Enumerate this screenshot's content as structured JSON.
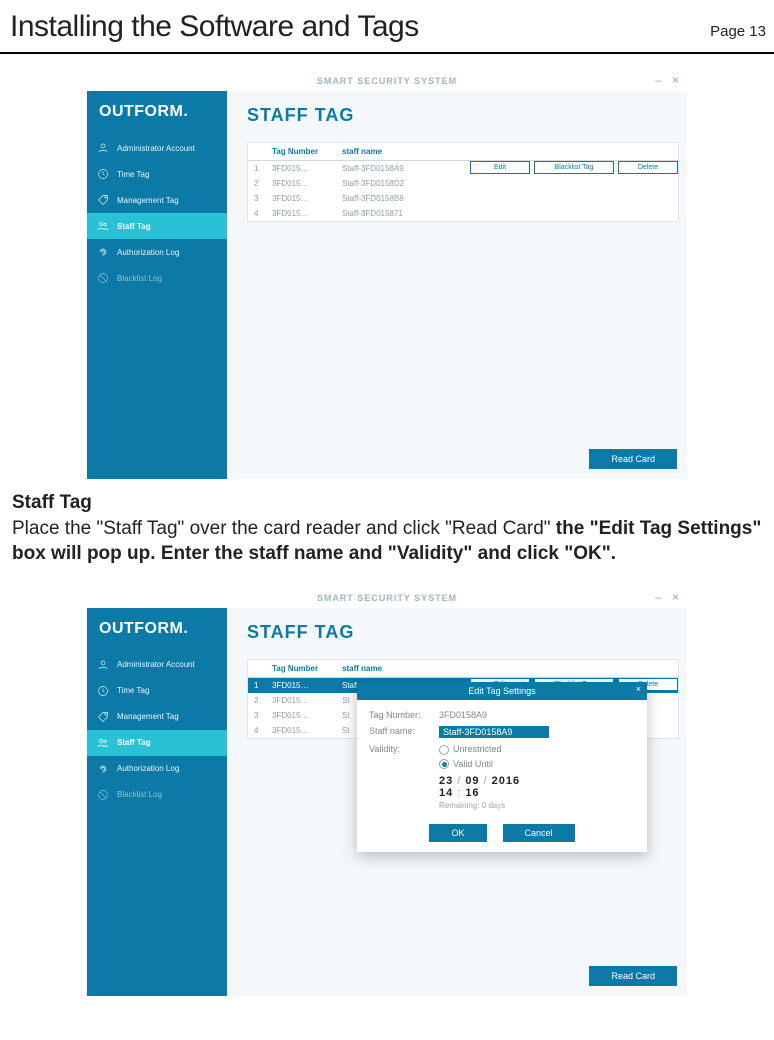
{
  "page": {
    "title": "Installing the Software and Tags",
    "number": "Page 13"
  },
  "app": {
    "brand": "OUTFORM.",
    "windowTitle": "SMART SECURITY SYSTEM",
    "winMinimize": "–",
    "winClose": "×",
    "mainTitle": "STAFF TAG",
    "readCard": "Read Card"
  },
  "sidebar": [
    {
      "label": "Administrator Account",
      "icon": "user"
    },
    {
      "label": "Time Tag",
      "icon": "clock"
    },
    {
      "label": "Management Tag",
      "icon": "tag"
    },
    {
      "label": "Staff Tag",
      "icon": "people",
      "active": true
    },
    {
      "label": "Authorization Log",
      "icon": "finger"
    },
    {
      "label": "Blacklist Log",
      "icon": "ban",
      "dim": true
    }
  ],
  "table": {
    "headers": {
      "num": "Tag Number",
      "name": "staff name"
    },
    "rows": [
      {
        "idx": "1",
        "num": "3FD015…",
        "name": "Staff-3FD0158A9"
      },
      {
        "idx": "2",
        "num": "3FD015…",
        "name": "Staff-3FD0158D2"
      },
      {
        "idx": "3",
        "num": "3FD015…",
        "name": "Staff-3FD0158B8"
      },
      {
        "idx": "4",
        "num": "3FD015…",
        "name": "Staff-3FD015871"
      }
    ],
    "actions": {
      "edit": "Edit",
      "blacklist": "Blacklist Tag",
      "delete": "Delete"
    }
  },
  "table2": {
    "rows": [
      {
        "idx": "1",
        "num": "3FD015…",
        "name": "Staff-3FD0158A9"
      },
      {
        "idx": "2",
        "num": "3FD015…",
        "name": "St"
      },
      {
        "idx": "3",
        "num": "3FD015…",
        "name": "St"
      },
      {
        "idx": "4",
        "num": "3FD015…",
        "name": "St"
      }
    ]
  },
  "dialog": {
    "title": "Edit Tag Settings",
    "labels": {
      "tagNumber": "Tag Number:",
      "staffName": "Staff name:",
      "validity": "Validity:"
    },
    "tagNumber": "3FD0158A9",
    "staffName": "Staff-3FD0158A9",
    "options": {
      "unrestricted": "Unrestricted",
      "validUntil": "Valid Until"
    },
    "date": {
      "d": "23",
      "m": "09",
      "y": "2016",
      "hh": "14",
      "mm": "16"
    },
    "remaining": "Remaining: 0 days",
    "ok": "OK",
    "cancel": "Cancel"
  },
  "doc": {
    "h": "Staff Tag",
    "p1a": "Place the \"Staff Tag\" over the card reader and click \"Read Card\" ",
    "p1b": "the \"Edit Tag Settings\" box will pop up. Enter the staff name and \"Validity\" and click \"OK\"."
  }
}
